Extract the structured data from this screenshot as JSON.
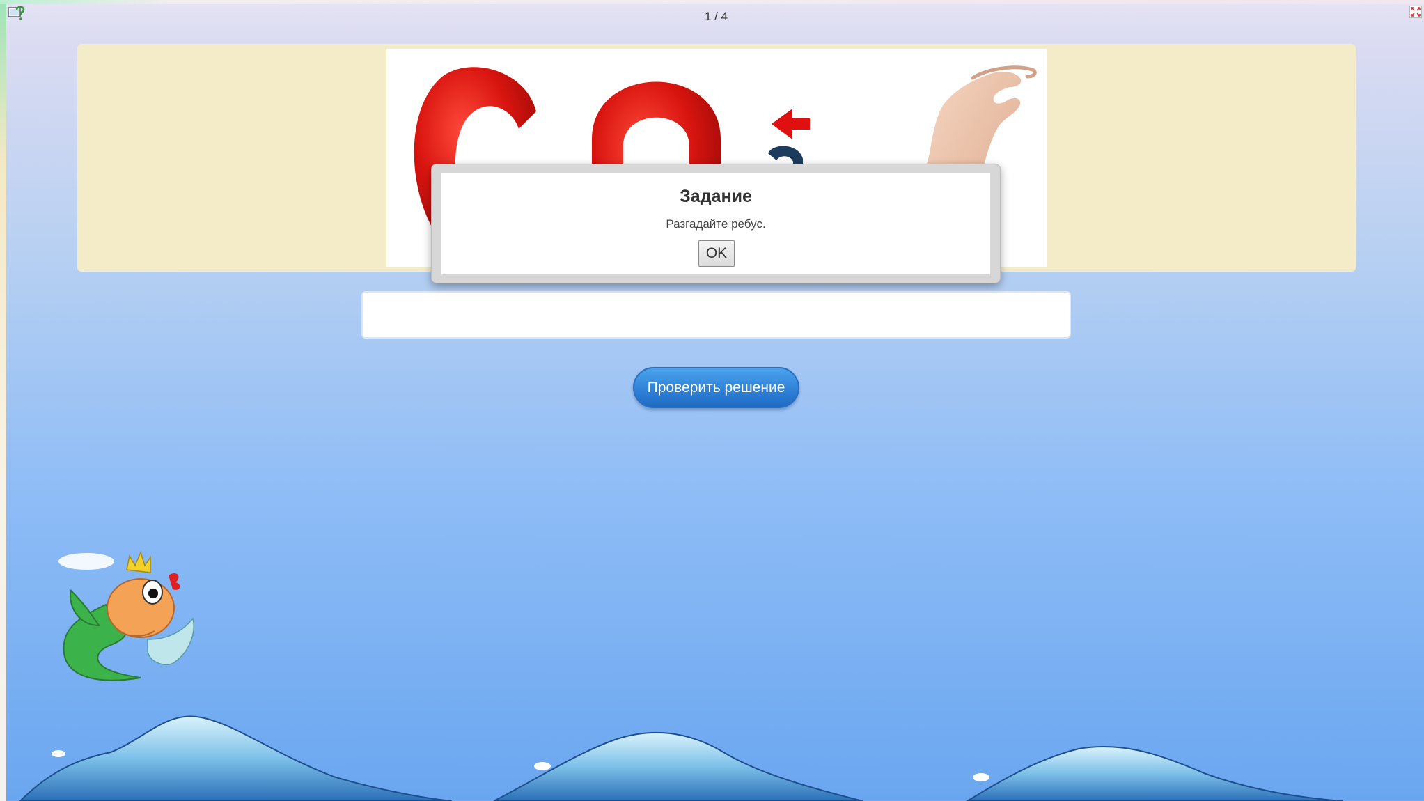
{
  "toolbar": {
    "help_icon": "help-question-icon",
    "fullscreen_icon": "fullscreen-toggle-icon",
    "slide_counter": "1 / 4"
  },
  "puzzle": {
    "image_letters": "CA",
    "panel_color": "#f4ecc9",
    "arrow_color": "#e01010"
  },
  "dialog": {
    "title": "Задание",
    "message": "Разгадайте ребус.",
    "ok_label": "OK"
  },
  "answer": {
    "value": "",
    "placeholder": ""
  },
  "check_button": {
    "label": "Проверить решение",
    "color": "#2e7fd6"
  },
  "decorations": {
    "fish": "goldfish-illustration",
    "waves": "sea-waves-illustration"
  }
}
